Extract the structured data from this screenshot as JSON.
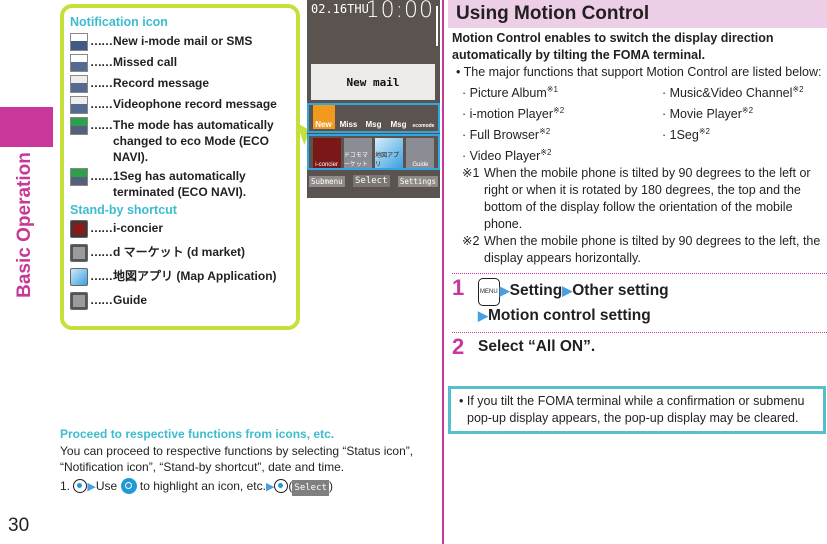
{
  "page": {
    "section_tab_label": "Basic Operation",
    "page_number": "30"
  },
  "info_box": {
    "notification_heading": "Notification icon",
    "dots": "……",
    "notification_icons": [
      {
        "icon": "new-mail-icon",
        "label": "New i-mode mail or SMS"
      },
      {
        "icon": "missed-call-icon",
        "label": "Missed call"
      },
      {
        "icon": "record-message-icon",
        "label": "Record message"
      },
      {
        "icon": "videophone-record-message-icon",
        "label": "Videophone record message"
      },
      {
        "icon": "eco-mode-icon",
        "label": "The mode has automatically changed to eco Mode (ECO NAVI)."
      },
      {
        "icon": "1seg-off-icon",
        "label": "1Seg has automatically terminated (ECO NAVI)."
      }
    ],
    "standby_heading": "Stand-by shortcut",
    "standby_shortcuts": [
      {
        "icon": "i-concier-icon",
        "label": "i-concier"
      },
      {
        "icon": "d-market-icon",
        "label": "d マーケット (d market)"
      },
      {
        "icon": "map-app-icon",
        "label": "地図アプリ (Map Application)"
      },
      {
        "icon": "guide-icon",
        "label": "Guide"
      }
    ]
  },
  "phone_screen": {
    "date": "02.16THU",
    "time": "10:00",
    "popup_text": "New mail",
    "notif_labels": [
      "New",
      "Miss",
      "Msg",
      "Msg",
      "ecomode"
    ],
    "shortcut_labels": [
      "i-concier",
      "ドコモマーケット",
      "地図アプリ",
      "Guide"
    ],
    "softkeys": {
      "left": "Submenu",
      "center": "Select",
      "right": "Settings"
    }
  },
  "proceed": {
    "heading": "Proceed to respective functions from icons, etc.",
    "body": "You can proceed to respective functions by selecting “Status icon”, “Notification icon”, “Stand-by shortcut”, date and time.",
    "step_prefix": "1.",
    "step_use": "Use",
    "step_mid": "to highlight an icon, etc.",
    "select_key": "Select",
    "open_paren": "(",
    "close_paren": ")"
  },
  "motion_control": {
    "title": "Using Motion Control",
    "intro": "Motion Control enables to switch the display direction automatically by tilting the FOMA terminal.",
    "bullet": "• The major functions that support Motion Control are listed below:",
    "functions": [
      {
        "name": "· Picture Album",
        "note": "※1"
      },
      {
        "name": "· Music&Video Channel",
        "note": "※2"
      },
      {
        "name": "· i-motion Player",
        "note": "※2"
      },
      {
        "name": "· Movie Player",
        "note": "※2"
      },
      {
        "name": "· Full Browser",
        "note": "※2"
      },
      {
        "name": "· 1Seg",
        "note": "※2"
      },
      {
        "name": "· Video Player",
        "note": "※2"
      },
      {
        "name": "",
        "note": ""
      }
    ],
    "notes": [
      {
        "mark": "※1",
        "text": "When the mobile phone is tilted by 90 degrees to the left or right or when it is rotated by 180 degrees, the top and the bottom of the display follow the orientation of the mobile phone."
      },
      {
        "mark": "※2",
        "text": "When the mobile phone is tilted by 90 degrees to the left, the display appears horizontally."
      }
    ],
    "steps": [
      {
        "num": "1",
        "menu_key": "MENU",
        "path": [
          "Setting",
          "Other setting",
          "Motion control setting"
        ]
      },
      {
        "num": "2",
        "text": "Select “All ON”."
      }
    ],
    "caution": "• If you tilt the FOMA terminal while a confirmation or submenu pop-up display appears, the pop-up display may be cleared."
  },
  "colors": {
    "accent_magenta": "#c8389a",
    "heading_cyan": "#3dbcd0",
    "box_green": "#c6df3a",
    "title_band": "#eccfe6",
    "highlight_blue": "#2fa6e0"
  }
}
